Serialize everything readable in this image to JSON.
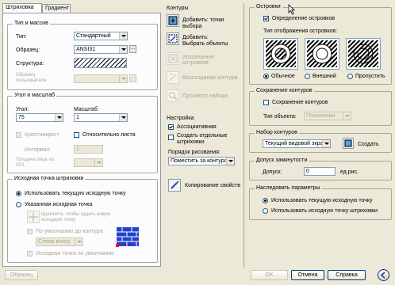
{
  "tabs": {
    "hatch": "Штриховка",
    "gradient": "Градиент"
  },
  "type_pattern": {
    "title": "Тип и массив",
    "type_label": "Тип:",
    "type_value": "Стандартный",
    "pattern_label": "Образец:",
    "pattern_value": "ANSI31",
    "structure_label": "Структура:",
    "custom_label": "Образец пользователя:"
  },
  "angle_scale": {
    "title": "Угол и масштаб",
    "angle_label": "Угол:",
    "angle_value": "75",
    "scale_label": "Масштаб",
    "scale_value": "1",
    "crosshatch_label": "Крестнакрест",
    "relative_label": "Относительно листа",
    "spacing_label": "Интервал:",
    "spacing_value": "1",
    "iso_label": "Толщина пера по ISO:"
  },
  "origin": {
    "title": "Исходная точка штриховки",
    "use_current": "Использовать текущую исходную точку",
    "specified": "Указанная исходная точка",
    "click_new": "Щелкните, чтобы задать новую исходную точку",
    "default_boundary": "По умолчанию до контура",
    "position_value": "Слева внизу",
    "store_default": "Исходная точка по умолчанию"
  },
  "contours": {
    "title": "Контуры",
    "add_pick": "Добавить: точки выбора",
    "add_select": "Добавить: Выбрать объекты",
    "remove_islands": "Исключение островков",
    "recreate": "Воссоздание контура",
    "view": "Просмотр набора"
  },
  "options": {
    "title": "Настройка",
    "associative": "Ассоциативная",
    "separate": "Создать отдельные штриховки",
    "draw_order_label": "Порядок рисования:",
    "draw_order_value": "Поместить за контуром",
    "inherit": "Копирование свойств"
  },
  "islands": {
    "title": "Островки",
    "detect": "Определение островков",
    "display_style": "Тип отображения островков:",
    "normal": "Обычное",
    "outer": "Внешний",
    "ignore": "Пропустить"
  },
  "retain": {
    "title": "Сохранение контуров",
    "retain_label": "Сохранение контуров",
    "object_type_label": "Тип объекта:",
    "object_type_value": "Полилиния"
  },
  "boundary_set": {
    "title": "Набор контуров",
    "value": "Текущий видовой экран",
    "new": "Создать"
  },
  "gap": {
    "title": "Допуск замкнутости",
    "label": "Допуск:",
    "value": "0",
    "unit": "ед.рис."
  },
  "inherit_opts": {
    "title": "Наследовать параметры",
    "use_current": "Использовать текущую исходную точку",
    "use_source": "Использовать исходную точку штриховки"
  },
  "footer": {
    "preview": "Образец",
    "ok": "OK",
    "cancel": "Отмена",
    "help": "Справка"
  }
}
